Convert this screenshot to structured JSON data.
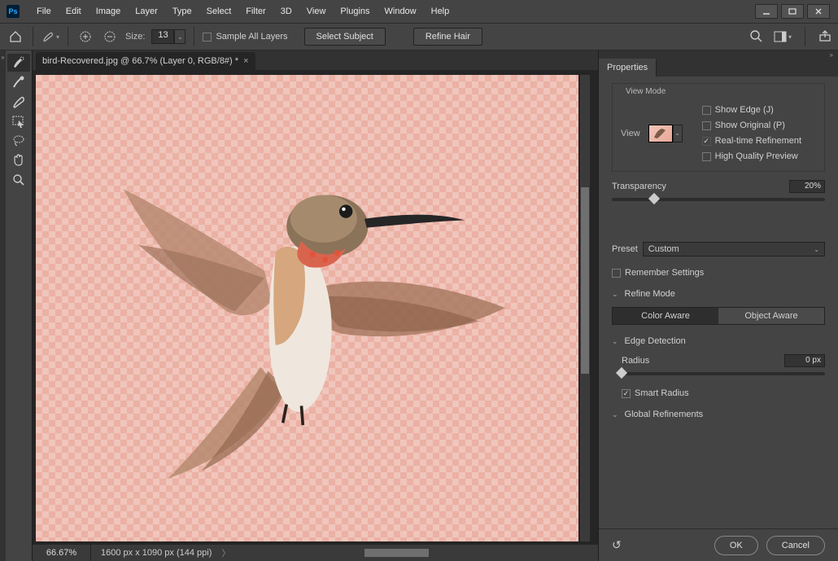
{
  "menu": [
    "File",
    "Edit",
    "Image",
    "Layer",
    "Type",
    "Select",
    "Filter",
    "3D",
    "View",
    "Plugins",
    "Window",
    "Help"
  ],
  "options": {
    "size_label": "Size:",
    "size_value": "13",
    "sample_all_layers": "Sample All Layers",
    "select_subject": "Select Subject",
    "refine_hair": "Refine Hair"
  },
  "doc": {
    "tab_title": "bird-Recovered.jpg @ 66.7% (Layer 0, RGB/8#) *",
    "zoom": "66.67%",
    "dimensions": "1600 px x 1090 px (144 ppi)"
  },
  "panel": {
    "title": "Properties",
    "view_mode": "View Mode",
    "view_label": "View",
    "show_edge": "Show Edge (J)",
    "show_original": "Show Original (P)",
    "realtime": "Real-time Refinement",
    "high_quality": "High Quality Preview",
    "transparency_label": "Transparency",
    "transparency_value": "20%",
    "preset_label": "Preset",
    "preset_value": "Custom",
    "remember": "Remember Settings",
    "refine_mode": "Refine Mode",
    "color_aware": "Color Aware",
    "object_aware": "Object Aware",
    "edge_detection": "Edge Detection",
    "radius_label": "Radius",
    "radius_value": "0 px",
    "smart_radius": "Smart Radius",
    "global_refinements": "Global Refinements",
    "ok": "OK",
    "cancel": "Cancel"
  }
}
